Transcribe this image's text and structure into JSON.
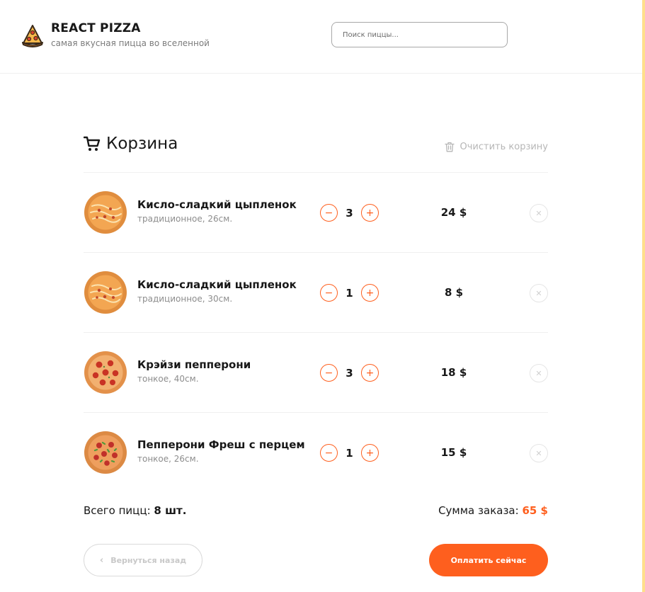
{
  "header": {
    "title": "REACT PIZZA",
    "subtitle": "самая вкусная пицца во вселенной",
    "search_placeholder": "Поиск пиццы..."
  },
  "cart": {
    "title": "Корзина",
    "clear_label": "Очистить корзину",
    "items": [
      {
        "name": "Кисло-сладкий цыпленок",
        "desc": "традиционное, 26см.",
        "count": "3",
        "price": "24 $",
        "image": "sweet-sour-chicken-pizza"
      },
      {
        "name": "Кисло-сладкий цыпленок",
        "desc": "традиционное, 30см.",
        "count": "1",
        "price": "8 $",
        "image": "sweet-sour-chicken-pizza"
      },
      {
        "name": "Крэйзи пепперони",
        "desc": "тонкое, 40см.",
        "count": "3",
        "price": "18 $",
        "image": "crazy-pepperoni-pizza"
      },
      {
        "name": "Пепперони Фреш с перцем",
        "desc": "тонкое, 26см.",
        "count": "1",
        "price": "15 $",
        "image": "pepperoni-fresh-pizza"
      }
    ],
    "minus_glyph": "−",
    "plus_glyph": "+",
    "remove_glyph": "✕"
  },
  "summary": {
    "total_label": "Всего пицц:",
    "total_value": "8 шт.",
    "sum_label": "Сумма заказа:",
    "sum_value": "65 $"
  },
  "buttons": {
    "back_label": "Вернуться назад",
    "pay_label": "Оплатить сейчас"
  },
  "colors": {
    "accent": "#fe5f1e",
    "side_border": "#ffdf8c"
  }
}
